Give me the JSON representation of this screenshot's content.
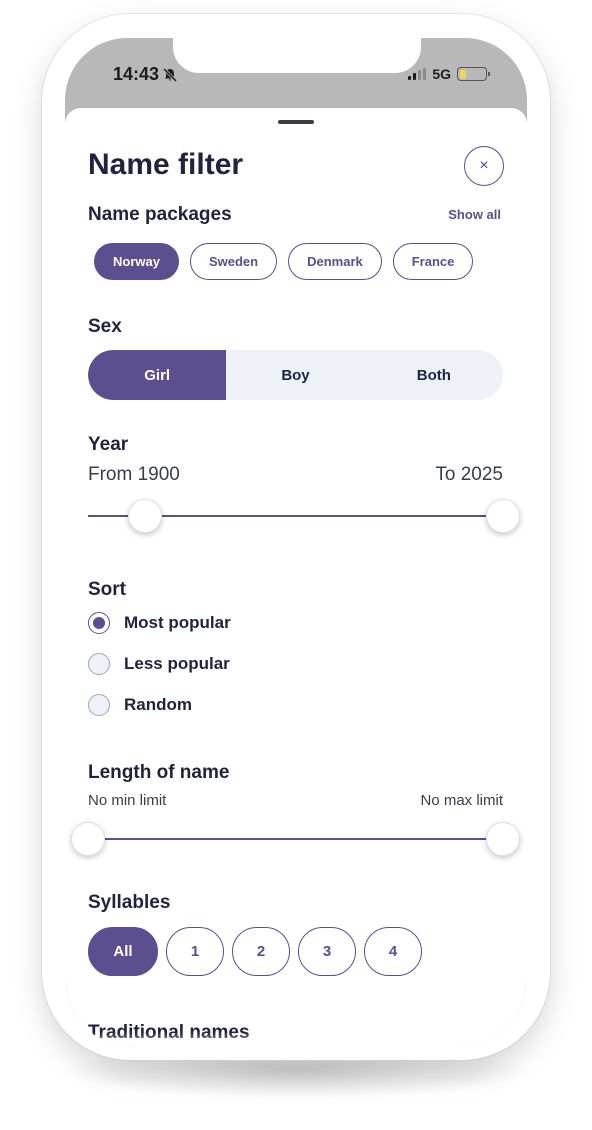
{
  "status_bar": {
    "time": "14:43",
    "network": "5G"
  },
  "sheet": {
    "title": "Name filter",
    "close_icon": "×"
  },
  "name_packages": {
    "label": "Name packages",
    "show_all": "Show all",
    "items": [
      "Norway",
      "Sweden",
      "Denmark",
      "France"
    ],
    "selected": "Norway"
  },
  "sex": {
    "label": "Sex",
    "options": [
      "Girl",
      "Boy",
      "Both"
    ],
    "selected": "Girl"
  },
  "year": {
    "label": "Year",
    "from_label": "From 1900",
    "to_label": "To 2025",
    "from_value": 1900,
    "to_value": 2025,
    "slider_min_fraction": 0.14,
    "slider_max_fraction": 1.0
  },
  "sort": {
    "label": "Sort",
    "options": [
      "Most popular",
      "Less popular",
      "Random"
    ],
    "selected": "Most popular"
  },
  "length": {
    "label": "Length of name",
    "min_label": "No min limit",
    "max_label": "No max limit",
    "slider_min_fraction": 0.0,
    "slider_max_fraction": 1.0
  },
  "syllables": {
    "label": "Syllables",
    "options": [
      "All",
      "1",
      "2",
      "3",
      "4"
    ],
    "selected": "All"
  },
  "traditional": {
    "label": "Traditional names"
  },
  "colors": {
    "accent": "#5c4e8f",
    "text_dark": "#1f2340",
    "segment_bg": "#eef1f8"
  }
}
